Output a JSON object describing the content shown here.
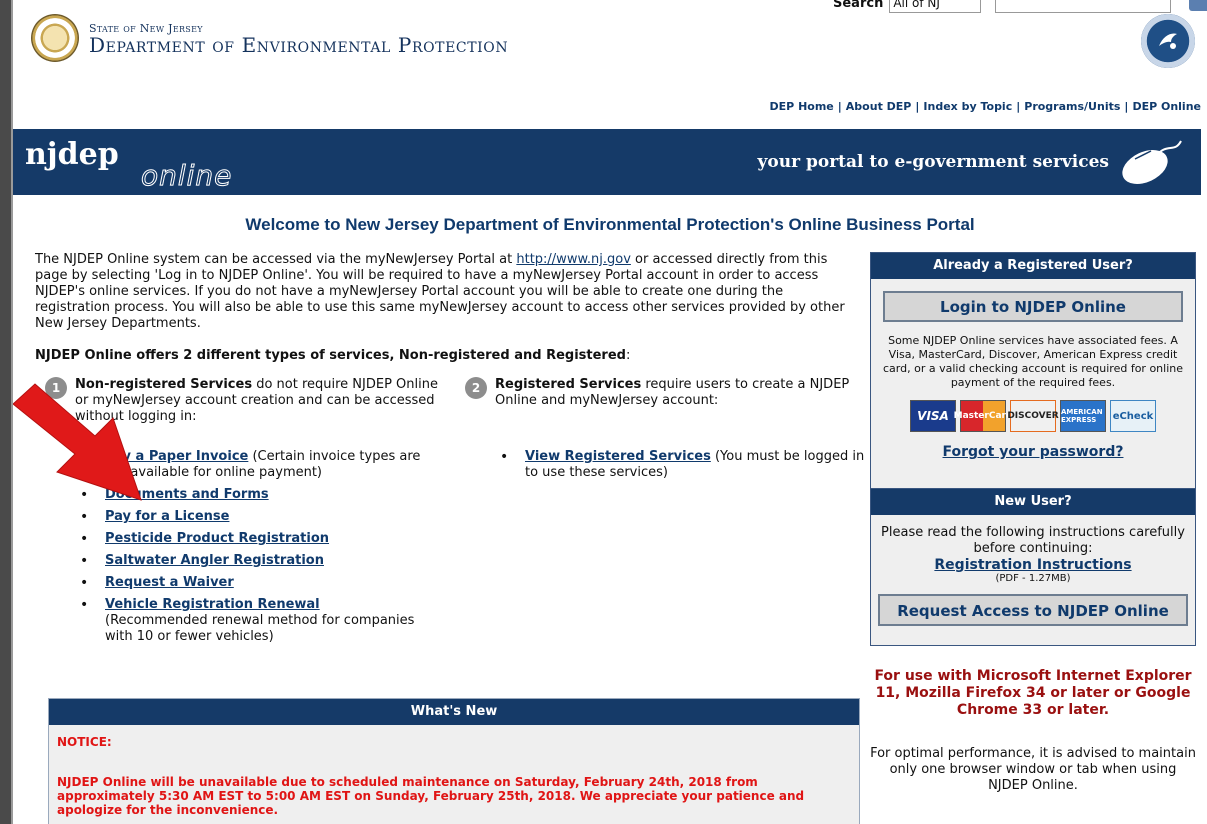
{
  "header": {
    "search_label": "Search",
    "search_scope": "All of NJ",
    "state": "State of New Jersey",
    "department": "Department of Environmental Protection",
    "nav": [
      "DEP Home",
      "About DEP",
      "Index by Topic",
      "Programs/Units",
      "DEP Online"
    ]
  },
  "banner": {
    "brand": "njdep",
    "brand_suffix": "online",
    "tagline": "your portal to e-government services"
  },
  "welcome": "Welcome to New Jersey Department of Environmental Protection's Online Business Portal",
  "intro": {
    "before": "The NJDEP Online system can be accessed via the myNewJersey Portal at ",
    "link": "http://www.nj.gov",
    "after": " or accessed directly from this page by selecting 'Log in to NJDEP Online'. You will be required to have a myNewJersey Portal account in order to access NJDEP's online services. If you do not have a myNewJersey Portal account you will be able to create one during the registration process. You will also be able to use this same myNewJersey account to access other services provided by other New Jersey Departments."
  },
  "offers": {
    "lead": "NJDEP Online offers 2 different types of services, Non-registered and Registered",
    "tail": ":"
  },
  "non_registered": {
    "number": "1",
    "title": "Non-registered Services",
    "desc": " do not require NJDEP Online or myNewJersey account creation and can be accessed without logging in:",
    "items": [
      {
        "link": "Pay a Paper Invoice",
        "note": " (Certain invoice types are not available for online payment)"
      },
      {
        "link": "Documents and Forms",
        "note": ""
      },
      {
        "link": "Pay for a License",
        "note": ""
      },
      {
        "link": "Pesticide Product Registration",
        "note": ""
      },
      {
        "link": "Saltwater Angler Registration",
        "note": ""
      },
      {
        "link": "Request a Waiver",
        "note": ""
      },
      {
        "link": "Vehicle Registration Renewal",
        "note": " (Recommended renewal method for companies with 10 or fewer vehicles)"
      }
    ]
  },
  "registered": {
    "number": "2",
    "title": "Registered Services",
    "desc": " require users to create a NJDEP Online and myNewJersey account:",
    "items": [
      {
        "link": "View Registered Services",
        "note": " (You must be logged in to use these services)"
      }
    ]
  },
  "whats_new": {
    "title": "What's New",
    "notice_title": "NOTICE:",
    "notice_text": "NJDEP Online will be unavailable due to scheduled maintenance on Saturday, February 24th, 2018 from approximately 5:30 AM EST to 5:00 AM EST on Sunday, February 25th, 2018. We appreciate your patience and apologize for the inconvenience."
  },
  "registered_panel": {
    "title": "Already a Registered User?",
    "login_button": "Login to NJDEP Online",
    "fees_text": "Some NJDEP Online services have associated fees. A Visa, MasterCard, Discover, American Express credit card, or a valid checking account is required for online payment of the required fees.",
    "cards": [
      "VISA",
      "MasterCard",
      "DISCOVER",
      "AMERICAN EXPRESS",
      "eCheck"
    ],
    "forgot": "Forgot your password?"
  },
  "new_user_panel": {
    "title": "New User?",
    "text": "Please read the following instructions carefully before continuing:",
    "instructions_link": "Registration Instructions",
    "pdf_note": "(PDF - 1.27MB)",
    "access_button": "Request Access to NJDEP Online"
  },
  "browser_note": "For use with Microsoft Internet Explorer 11, Mozilla Firefox 34 or later or Google Chrome 33 or later.",
  "optimal_note": "For optimal performance, it is advised to maintain only one browser window or tab when using NJDEP Online.",
  "colors": {
    "navy": "#153a68",
    "link": "#103a6c",
    "notice_red": "#e01515",
    "arrow_red": "#e01919"
  }
}
